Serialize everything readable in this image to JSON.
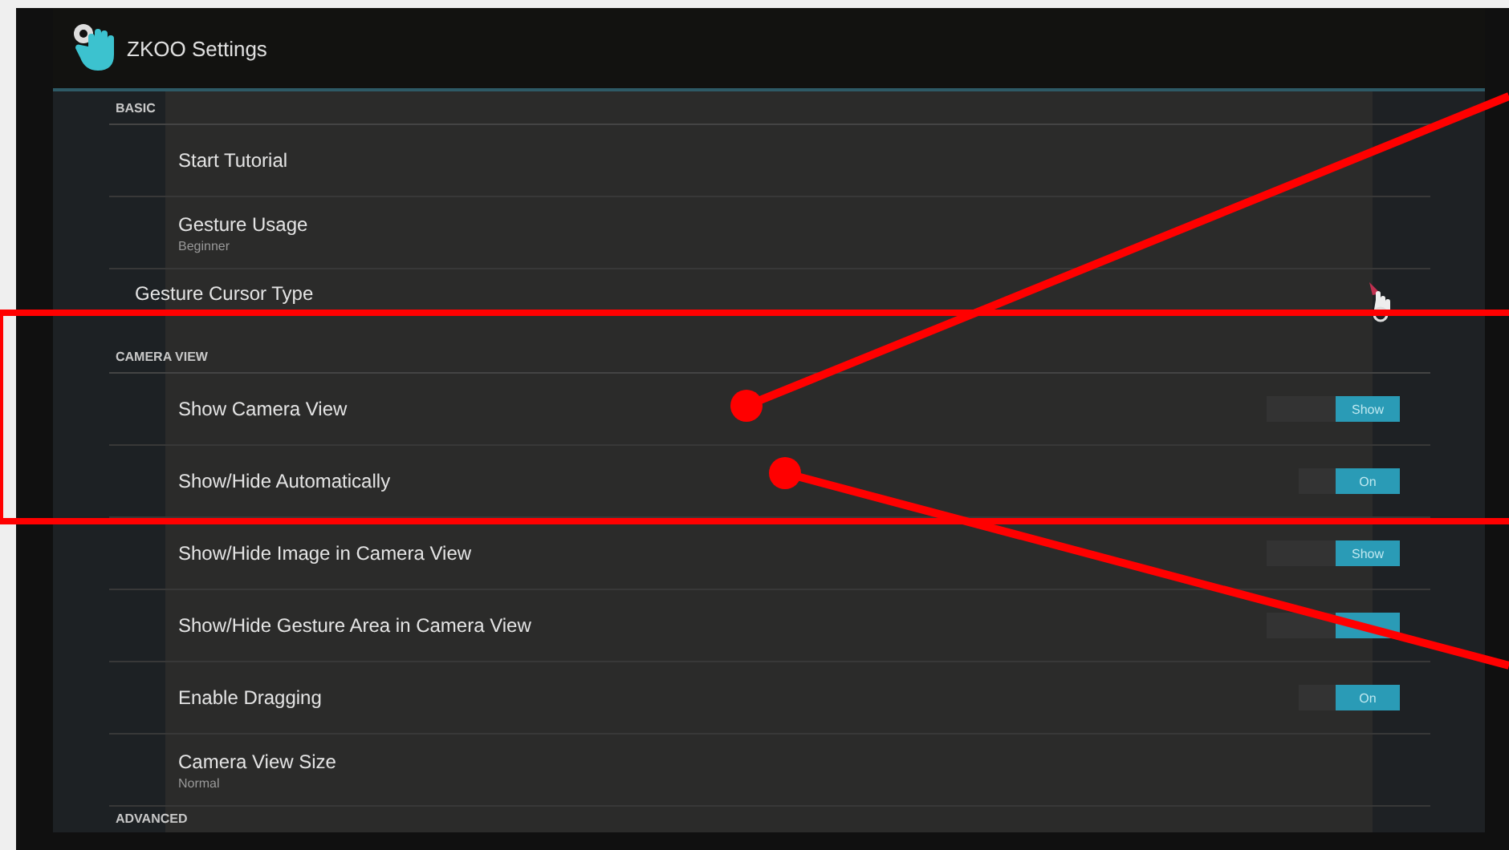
{
  "window": {
    "title": "ZKOO Settings"
  },
  "sections": [
    {
      "title": "BASIC",
      "items": [
        {
          "kind": "action",
          "label": "Start Tutorial"
        },
        {
          "kind": "value",
          "label": "Gesture Usage",
          "subtitle": "Beginner"
        },
        {
          "kind": "list",
          "label": "Gesture Cursor Type"
        }
      ]
    },
    {
      "title": "CAMERA VIEW",
      "items": [
        {
          "kind": "toggle",
          "label": "Show Camera View",
          "toggle": {
            "label": "Show",
            "on": true
          }
        },
        {
          "kind": "toggle",
          "label": "Show/Hide Automatically",
          "toggle": {
            "label": "On",
            "on": true
          }
        },
        {
          "kind": "toggle",
          "label": "Show/Hide Image in Camera View",
          "toggle": {
            "label": "Show",
            "on": true
          }
        },
        {
          "kind": "toggle",
          "label": "Show/Hide Gesture Area in Camera View",
          "toggle": {
            "on": true
          }
        },
        {
          "kind": "toggle",
          "label": "Enable Dragging",
          "toggle": {
            "label": "On",
            "on": true
          }
        },
        {
          "kind": "value",
          "label": "Camera View Size",
          "subtitle": "Normal"
        }
      ]
    },
    {
      "title": "ADVANCED"
    }
  ],
  "annotations": [
    {
      "kind": "box"
    },
    {
      "kind": "pointer"
    },
    {
      "kind": "pointer"
    }
  ]
}
